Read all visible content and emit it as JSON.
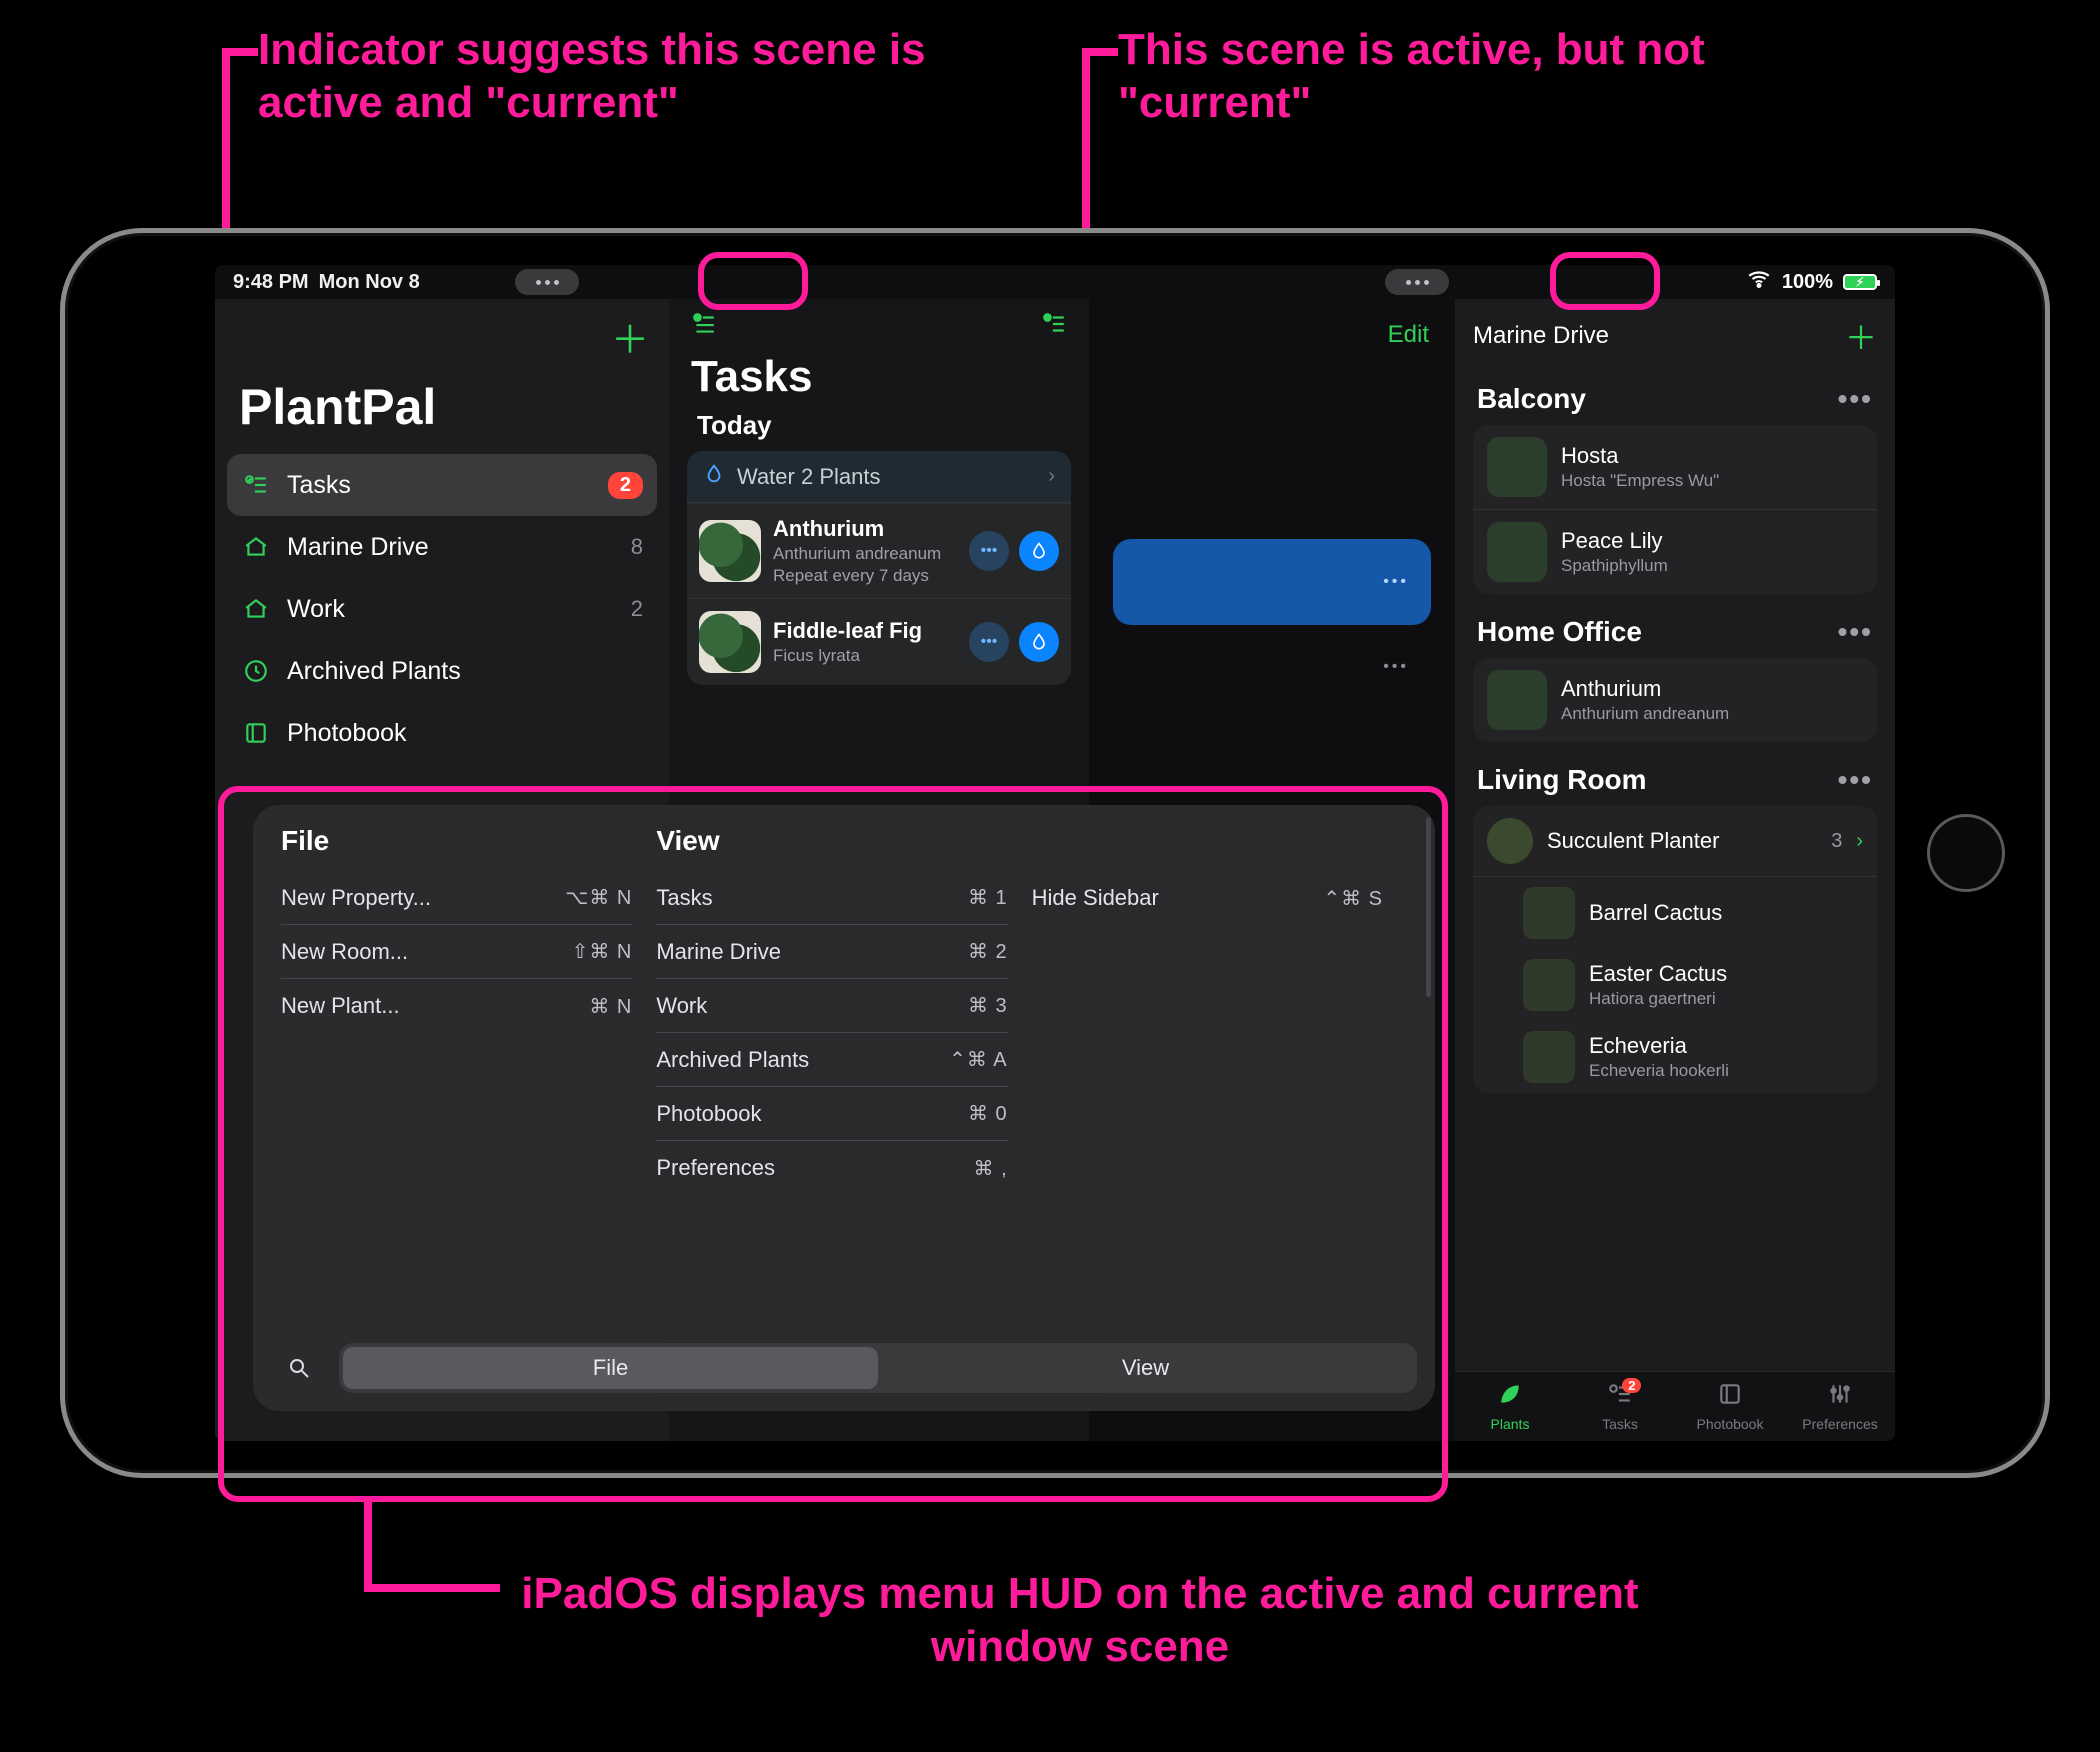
{
  "annotations": {
    "top_left": "Indicator suggests this scene is active and \"current\"",
    "top_right": "This scene is active, but not \"current\"",
    "bottom": "iPadOS displays menu HUD on the active and current window scene"
  },
  "status": {
    "time": "9:48 PM",
    "date": "Mon Nov 8",
    "battery_pct": "100%"
  },
  "sidebar": {
    "app_title": "PlantPal",
    "items": [
      {
        "icon": "checklist-icon",
        "label": "Tasks",
        "badge": "2",
        "selected": true
      },
      {
        "icon": "home-icon",
        "label": "Marine Drive",
        "trail": "8"
      },
      {
        "icon": "home-icon",
        "label": "Work",
        "trail": "2"
      },
      {
        "icon": "clock-icon",
        "label": "Archived Plants"
      },
      {
        "icon": "book-icon",
        "label": "Photobook"
      }
    ]
  },
  "tasks": {
    "title": "Tasks",
    "section": "Today",
    "group_label": "Water 2 Plants",
    "rows": [
      {
        "name": "Anthurium",
        "sci": "Anthurium andreanum",
        "repeat": "Repeat every 7 days"
      },
      {
        "name": "Fiddle-leaf Fig",
        "sci": "Ficus lyrata",
        "repeat": ""
      }
    ]
  },
  "mid": {
    "edit": "Edit"
  },
  "right": {
    "property": "Marine Drive",
    "rooms": [
      {
        "name": "Balcony",
        "plants": [
          {
            "name": "Hosta",
            "sci": "Hosta \"Empress Wu\""
          },
          {
            "name": "Peace Lily",
            "sci": "Spathiphyllum"
          }
        ]
      },
      {
        "name": "Home Office",
        "plants": [
          {
            "name": "Anthurium",
            "sci": "Anthurium andreanum"
          }
        ]
      },
      {
        "name": "Living Room",
        "group": {
          "name": "Succulent Planter",
          "count": "3"
        },
        "sub": [
          {
            "name": "Barrel Cactus",
            "sci": ""
          },
          {
            "name": "Easter Cactus",
            "sci": "Hatiora gaertneri"
          },
          {
            "name": "Echeveria",
            "sci": "Echeveria hookerli"
          }
        ]
      }
    ]
  },
  "tabbar": {
    "tabs": [
      {
        "icon": "leaf-icon",
        "label": "Plants",
        "active": true
      },
      {
        "icon": "checklist-icon",
        "label": "Tasks",
        "badge": "2"
      },
      {
        "icon": "book-icon",
        "label": "Photobook"
      },
      {
        "icon": "sliders-icon",
        "label": "Preferences"
      }
    ]
  },
  "hud": {
    "columns": [
      {
        "title": "File",
        "items": [
          {
            "label": "New Property...",
            "shortcut": "⌥⌘ N"
          },
          {
            "label": "New Room...",
            "shortcut": "⇧⌘ N"
          },
          {
            "label": "New Plant...",
            "shortcut": "⌘ N"
          }
        ]
      },
      {
        "title": "View",
        "items": [
          {
            "label": "Tasks",
            "shortcut": "⌘ 1"
          },
          {
            "label": "Marine Drive",
            "shortcut": "⌘ 2"
          },
          {
            "label": "Work",
            "shortcut": "⌘ 3"
          },
          {
            "label": "Archived Plants",
            "shortcut": "⌃⌘ A"
          },
          {
            "label": "Photobook",
            "shortcut": "⌘ 0"
          },
          {
            "label": "Preferences",
            "shortcut": "⌘ ,"
          }
        ]
      },
      {
        "title": "",
        "items": [
          {
            "label": "Hide Sidebar",
            "shortcut": "⌃⌘ S"
          }
        ]
      }
    ],
    "segmented": {
      "options": [
        "File",
        "View"
      ],
      "selected": 0
    }
  }
}
